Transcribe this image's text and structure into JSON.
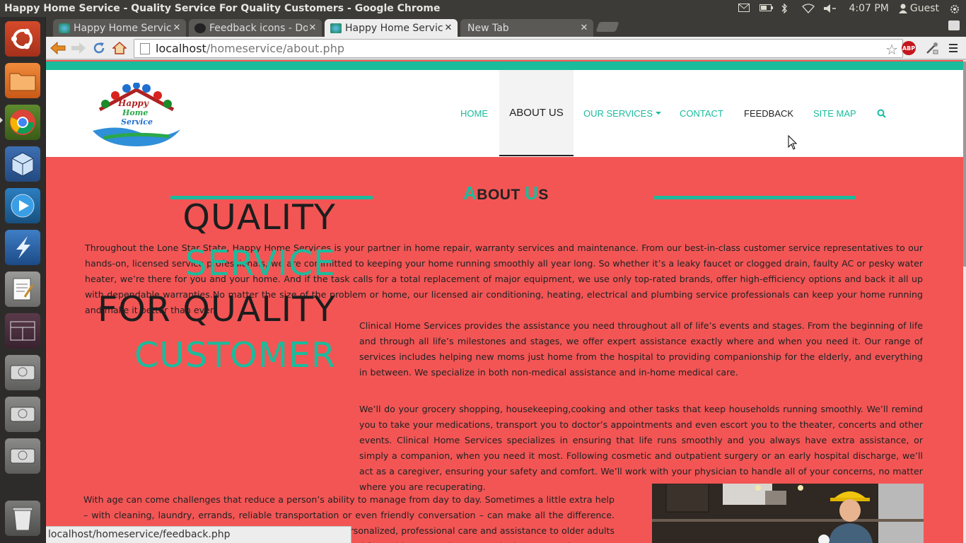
{
  "os": {
    "window_title": "Happy Home Service - Quality Service For Quality Customers - Google Chrome",
    "clock": "4:07 PM",
    "user": "Guest",
    "launcher_items": [
      "ubuntu-dash",
      "files",
      "chrome",
      "virtualbox",
      "media-player",
      "storm",
      "text-editor",
      "workspace-switcher",
      "drive-1",
      "drive-2",
      "drive-3",
      "trash"
    ]
  },
  "browser": {
    "tabs": [
      {
        "label": "Happy Home Service"
      },
      {
        "label": "Feedback icons - Dow"
      },
      {
        "label": "Happy Home Service"
      },
      {
        "label": "New Tab"
      }
    ],
    "url_host": "localhost",
    "url_path": "/homeservice/about.php",
    "status_url": "localhost/homeservice/feedback.php"
  },
  "site": {
    "logo_text": [
      "Happy",
      "Home",
      "Service"
    ],
    "nav": {
      "home": "HOME",
      "about": "ABOUT US",
      "services": "OUR SERVICES",
      "contact": "CONTACT",
      "feedback": "FEEDBACK",
      "sitemap": "SITE MAP"
    },
    "title_a": "A",
    "title_bout": "BOUT ",
    "title_u": "U",
    "title_s": "S",
    "intro": "Throughout the Lone Star State, Happy Home Services is your partner in home repair, warranty services and maintenance. From our best-in-class customer service representatives to our hands-on, licensed service professionals, we are committed to keeping your home running smoothly all year long. So whether it’s a leaky faucet or clogged drain, faulty AC or pesky water heater, we’re there for you and your home. And if the task calls for a total replacement of major equipment, we use only top-rated brands, offer high-efficiency options and back it all up with dependable warranties.No matter the size of the problem or home, our licensed air conditioning, heating, electrical and plumbing service professionals can keep your home running and make it better than ever.",
    "slogan": {
      "l1": "QUALITY",
      "l2": "SERVICE",
      "l3": "FOR QUALITY",
      "l4": "CUSTOMER"
    },
    "p2": "Clinical Home Services provides the assistance you need throughout all of life’s events and stages. From the beginning of life and through all life’s milestones and stages, we offer expert assistance exactly where and when you need it. Our range of services includes helping new moms just home from the hospital to providing companionship for the elderly, and everything in between. We specialize in both non-medical assistance and in-home medical care.",
    "p3": "We’ll do your grocery shopping, housekeeping,cooking and other tasks that keep households running smoothly. We’ll remind you to take your medications, transport you to doctor’s appointments and even escort you to the theater, concerts and other events. Clinical Home Services specializes in ensuring that life runs smoothly and you always have extra assistance, or simply a companion, when you need it most. Following cosmetic and outpatient surgery or an early hospital discharge, we’ll act as a caregiver, ensuring your safety and comfort. We’ll work with your physician to handle all of your concerns, no matter where you are recuperating.",
    "p4": "With age can come challenges that reduce a person’s ability to manage from day to day. Sometimes a little extra help – with cleaning, laundry, errands, reliable transportation or even friendly conversation – can make all the difference. That’s where Happy Home Services comes in, delivering personalized, professional care and assistance to older adults right in the comfort of their own homes. Our team was created for residents at Asbury’s Continuing Care Retirement"
  },
  "colors": {
    "accent": "#1abc9c",
    "page_bg": "#f35555",
    "text_dark": "#222222"
  }
}
